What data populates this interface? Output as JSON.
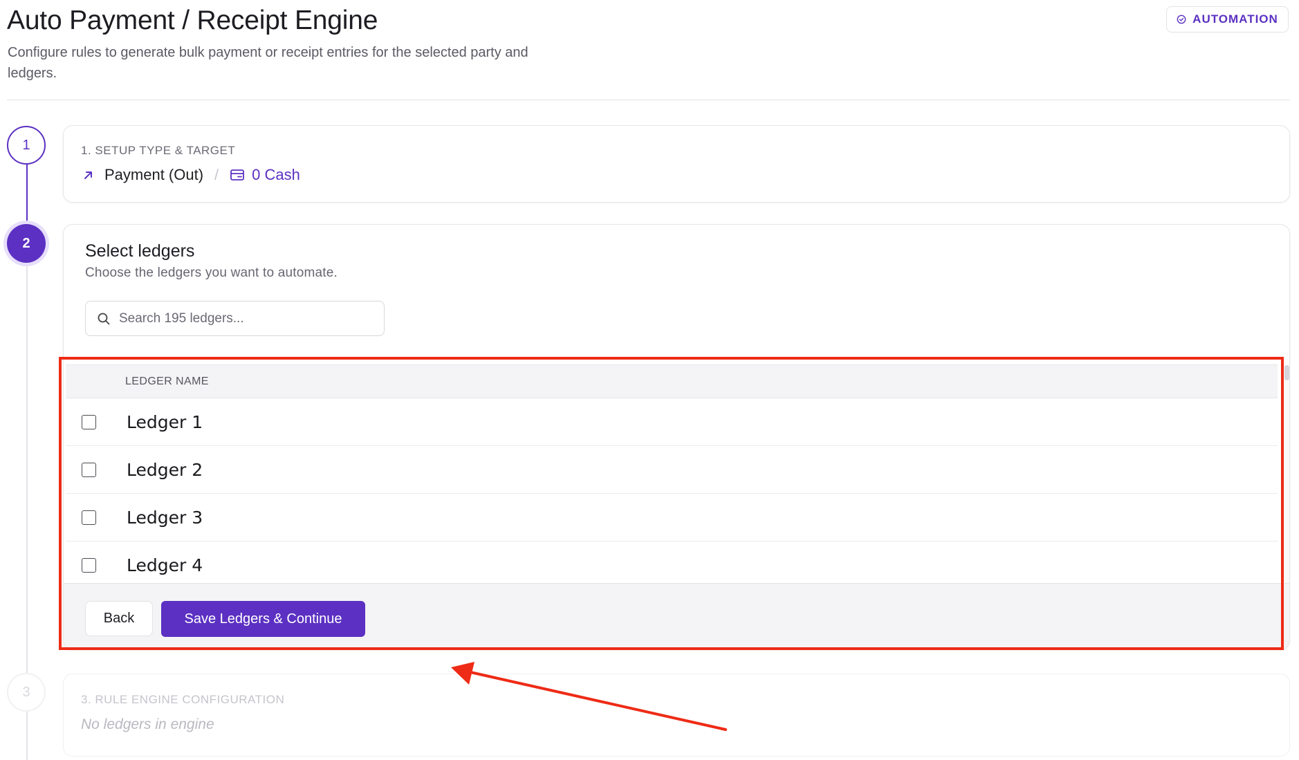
{
  "header": {
    "title": "Auto Payment / Receipt Engine",
    "subtitle": "Configure rules to generate bulk payment or receipt entries for the selected party and ledgers.",
    "badge_label": "AUTOMATION"
  },
  "stepper": {
    "steps": [
      {
        "number": "1",
        "state": "completed"
      },
      {
        "number": "2",
        "state": "active"
      },
      {
        "number": "3",
        "state": "disabled"
      }
    ]
  },
  "step1": {
    "eyebrow": "1. SETUP TYPE & TARGET",
    "type_label": "Payment (Out)",
    "separator": "/",
    "target_label": "0 Cash"
  },
  "step2": {
    "title": "Select ledgers",
    "description": "Choose the ledgers you want to automate.",
    "search": {
      "placeholder": "Search 195 ledgers...",
      "value": ""
    },
    "table": {
      "column_header": "LEDGER NAME",
      "rows": [
        {
          "name": "Ledger 1",
          "checked": false
        },
        {
          "name": "Ledger 2",
          "checked": false
        },
        {
          "name": "Ledger 3",
          "checked": false
        },
        {
          "name": "Ledger 4",
          "checked": false
        }
      ]
    },
    "back_label": "Back",
    "save_label": "Save Ledgers & Continue"
  },
  "step3": {
    "eyebrow": "3. RULE ENGINE CONFIGURATION",
    "empty_note": "No ledgers in engine"
  },
  "colors": {
    "accent": "#5b30c2",
    "annotation": "#ee2b16"
  }
}
